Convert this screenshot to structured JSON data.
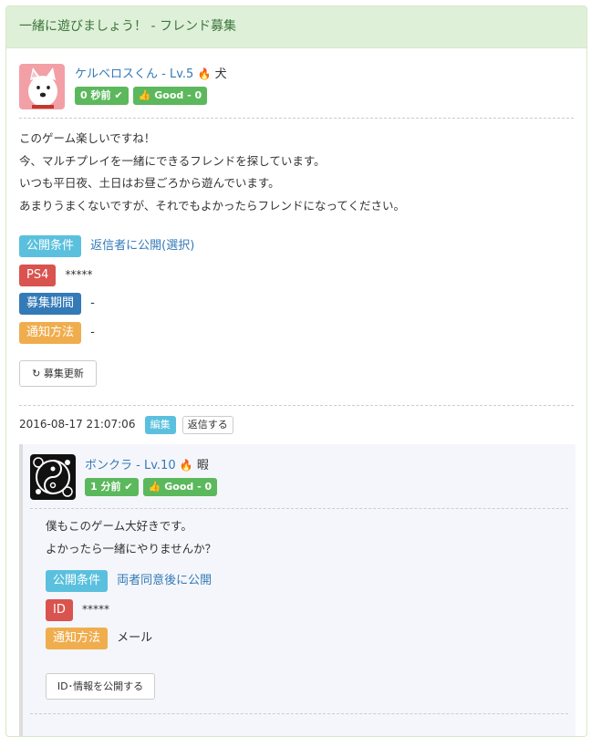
{
  "title": "一緒に遊びましょう！ - フレンド募集",
  "post": {
    "user_name": "ケルベロスくん",
    "level": "Lv.5",
    "nickname": "犬",
    "time_badge": "0 秒前",
    "good_badge": "Good - 0",
    "lines": [
      "このゲーム楽しいですね！",
      "今、マルチプレイを一緒にできるフレンドを探しています。",
      "いつも平日夜、土日はお昼ごろから遊んでいます。",
      "あまりうまくないですが、それでもよかったらフレンドになってください。"
    ],
    "visibility_label": "公開条件",
    "visibility_value": "返信者に公開(選択)",
    "platform_label": "PS4",
    "platform_value": "*****",
    "period_label": "募集期間",
    "period_value": "-",
    "notify_label": "通知方法",
    "notify_value": "-",
    "refresh_button": "募集更新"
  },
  "meta": {
    "timestamp": "2016-08-17 21:07:06",
    "edit_label": "編集",
    "reply_button": "返信する"
  },
  "reply": {
    "user_name": "ボンクラ",
    "level": "Lv.10",
    "nickname": "暇",
    "time_badge": "1 分前",
    "good_badge": "Good - 0",
    "lines": [
      "僕もこのゲーム大好きです。",
      "よかったら一緒にやりませんか？"
    ],
    "visibility_label": "公開条件",
    "visibility_value": "両者同意後に公開",
    "id_label": "ID",
    "id_value": "*****",
    "notify_label": "通知方法",
    "notify_value": "メール",
    "reveal_button": "ID･情報を公開する"
  },
  "colors": {
    "heading_bg": "#dff0d8",
    "success": "#5cb85c",
    "info": "#5bc0de",
    "danger": "#d9534f",
    "primary": "#337ab7",
    "warning": "#f0ad4e"
  }
}
